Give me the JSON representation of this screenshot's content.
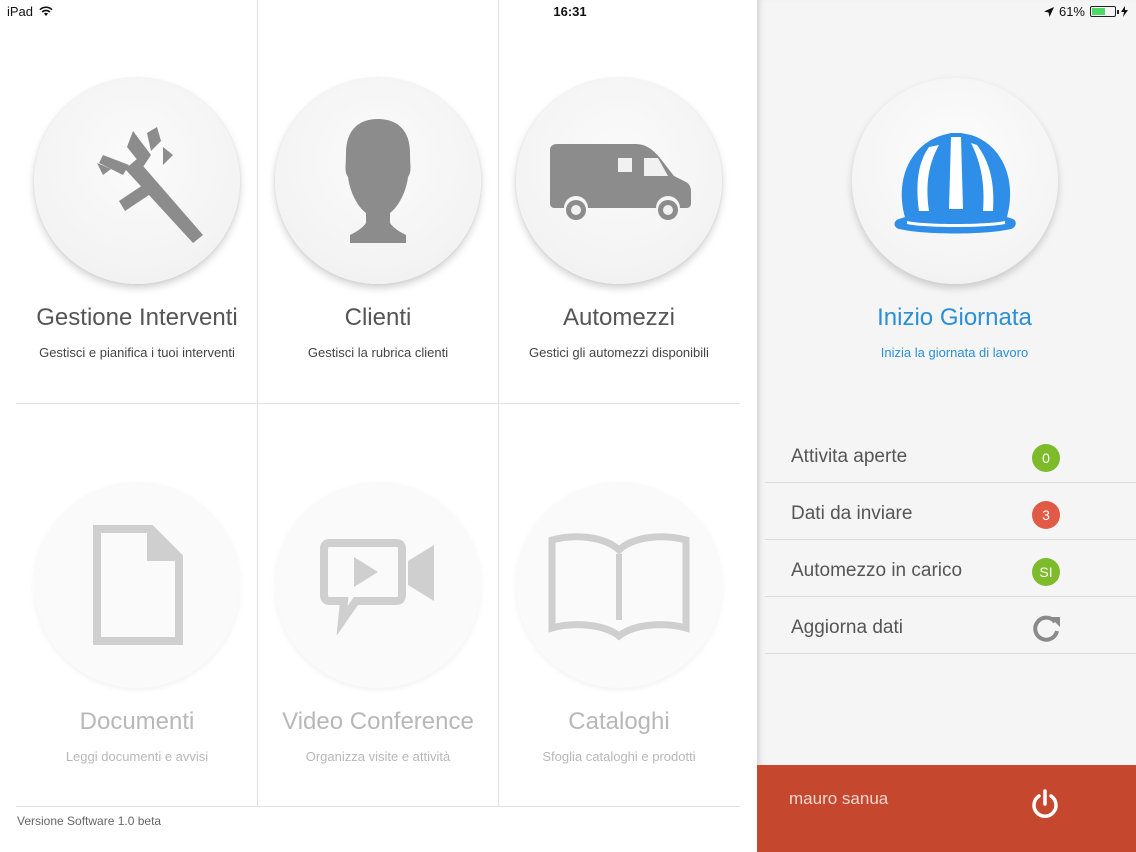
{
  "status": {
    "device": "iPad",
    "time": "16:31",
    "battery": "61%"
  },
  "tiles": [
    {
      "title": "Gestione Interventi",
      "subtitle": "Gestisci e pianifica i tuoi interventi",
      "icon": "caliper-icon"
    },
    {
      "title": "Clienti",
      "subtitle": "Gestisci la rubrica clienti",
      "icon": "person-icon"
    },
    {
      "title": "Automezzi",
      "subtitle": "Gestici gli automezzi disponibili",
      "icon": "van-icon"
    },
    {
      "title": "Documenti",
      "subtitle": "Leggi documenti e avvisi",
      "icon": "document-icon"
    },
    {
      "title": "Video Conference",
      "subtitle": "Organizza visite e attività",
      "icon": "video-chat-icon"
    },
    {
      "title": "Cataloghi",
      "subtitle": "Sfoglia cataloghi e prodotti",
      "icon": "book-icon"
    }
  ],
  "version": "Versione Software 1.0 beta",
  "side": {
    "title": "Inizio Giornata",
    "subtitle": "Inizia la giornata di lavoro",
    "icon": "hard-hat-icon",
    "rows": [
      {
        "label": "Attivita aperte",
        "badge": "0",
        "color": "#7dbb2a"
      },
      {
        "label": "Dati da inviare",
        "badge": "3",
        "color": "#e05a45"
      },
      {
        "label": "Automezzo in carico",
        "badge": "SI",
        "color": "#7dbb2a"
      },
      {
        "label": "Aggiorna dati",
        "icon": "refresh-icon"
      }
    ],
    "user": "mauro sanua"
  },
  "colors": {
    "accent": "#2a8fd6",
    "footer": "#c5482e",
    "green": "#7dbb2a",
    "red": "#e05a45"
  }
}
